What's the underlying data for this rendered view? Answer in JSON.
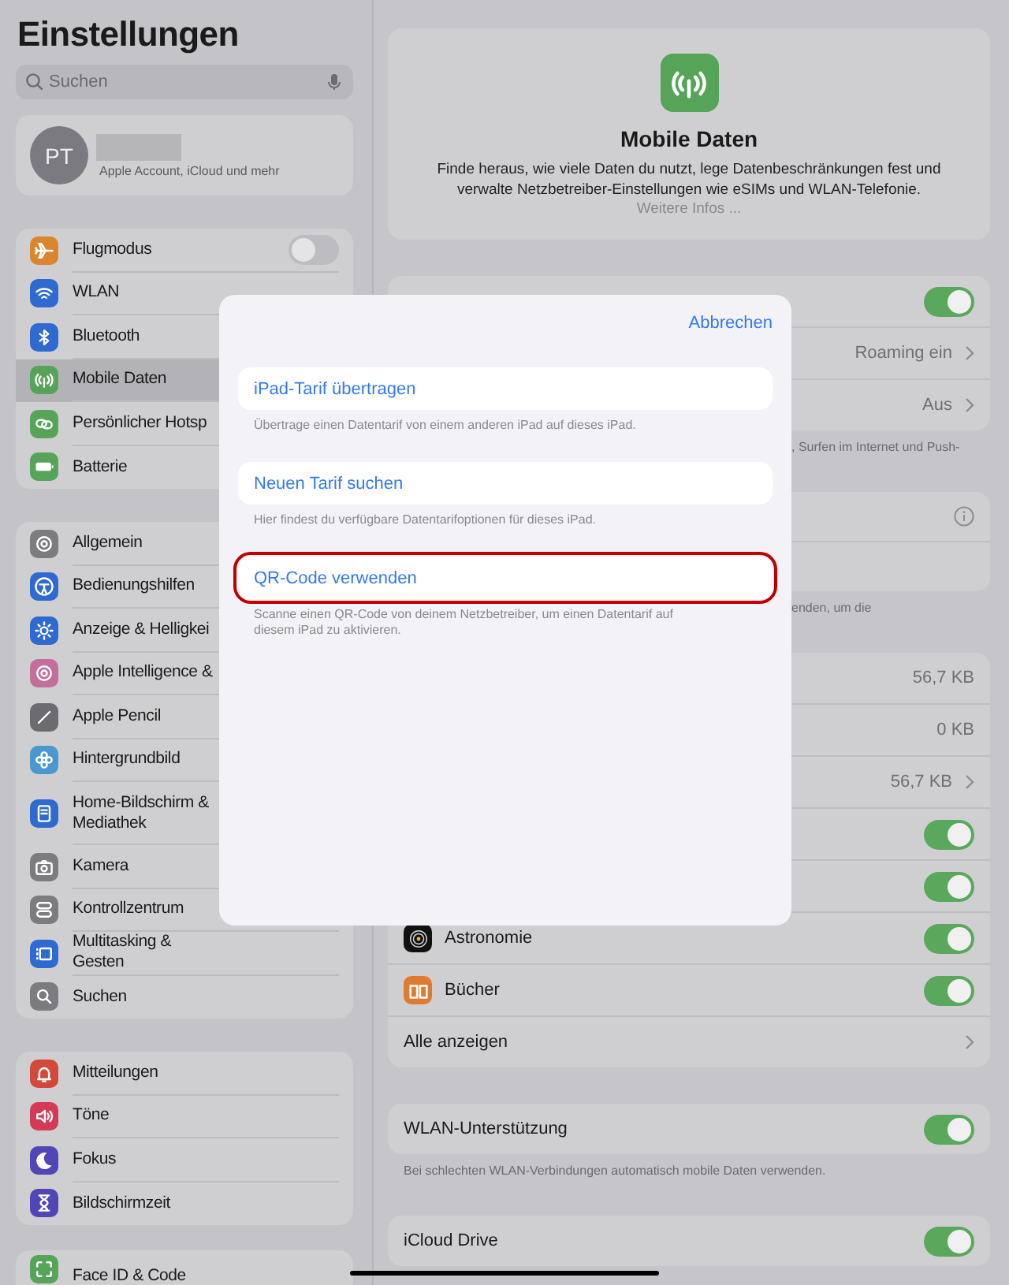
{
  "sidebar": {
    "title": "Einstellungen",
    "search": {
      "placeholder": "Suchen"
    },
    "account": {
      "initials": "PT",
      "subtitle": "Apple Account, iCloud und mehr"
    },
    "groups": [
      {
        "items": [
          {
            "label": "Flugmodus",
            "color": "#d9862f",
            "kind": "toggle",
            "on": false,
            "selected": false
          },
          {
            "label": "WLAN",
            "color": "#2f6ad0",
            "kind": "plain",
            "selected": false
          },
          {
            "label": "Bluetooth",
            "color": "#2f6ad0",
            "kind": "plain",
            "selected": false
          },
          {
            "label": "Mobile Daten",
            "color": "#55a458",
            "kind": "plain",
            "selected": true
          },
          {
            "label": "Persönlicher Hotsp",
            "color": "#55a458",
            "kind": "plain",
            "selected": false
          },
          {
            "label": "Batterie",
            "color": "#55a458",
            "kind": "plain",
            "selected": false
          }
        ]
      },
      {
        "items": [
          {
            "label": "Allgemein",
            "color": "#7c7c80",
            "kind": "plain",
            "selected": false
          },
          {
            "label": "Bedienungshilfen",
            "color": "#2f6ad0",
            "kind": "plain",
            "selected": false
          },
          {
            "label": "Anzeige & Helligkei",
            "color": "#2f6ad0",
            "kind": "plain",
            "selected": false
          },
          {
            "label": "Apple Intelligence &",
            "color": "#c46e9c",
            "kind": "plain",
            "selected": false
          },
          {
            "label": "Apple Pencil",
            "color": "#6c6c70",
            "kind": "plain",
            "selected": false
          },
          {
            "label": "Hintergrundbild",
            "color": "#4a98cc",
            "kind": "plain",
            "selected": false
          },
          {
            "label": "Home-Bildschirm & Mediathek",
            "color": "#2f6ad0",
            "kind": "plain",
            "selected": false
          },
          {
            "label": "Kamera",
            "color": "#7c7c80",
            "kind": "plain",
            "selected": false
          },
          {
            "label": "Kontrollzentrum",
            "color": "#7c7c80",
            "kind": "plain",
            "selected": false
          },
          {
            "label": "Multitasking & Gesten",
            "color": "#2f6ad0",
            "kind": "plain",
            "selected": false
          },
          {
            "label": "Suchen",
            "color": "#7c7c80",
            "kind": "plain",
            "selected": false
          }
        ]
      },
      {
        "items": [
          {
            "label": "Mitteilungen",
            "color": "#d4483a",
            "kind": "plain",
            "selected": false
          },
          {
            "label": "Töne",
            "color": "#d33a56",
            "kind": "plain",
            "selected": false
          },
          {
            "label": "Fokus",
            "color": "#5046b6",
            "kind": "plain",
            "selected": false
          },
          {
            "label": "Bildschirmzeit",
            "color": "#5046b6",
            "kind": "plain",
            "selected": false
          }
        ]
      },
      {
        "items": [
          {
            "label": "Face ID & Code",
            "color": "#55a458",
            "kind": "plain",
            "selected": false
          }
        ]
      }
    ]
  },
  "detail": {
    "header": {
      "title": "Mobile Daten",
      "text": "Finde heraus, wie viele Daten du nutzt, lege Datenbeschränkungen fest und verwalte Netzbetreiber-Einstellungen wie eSIMs und WLAN-Telefonie.",
      "link": "Weitere Infos ..."
    },
    "sections": [
      {
        "rows": [
          {
            "kind": "toggle",
            "on": true
          },
          {
            "kind": "value",
            "value": "Roaming ein",
            "chevron": true
          },
          {
            "kind": "value",
            "value": "Aus",
            "chevron": true
          }
        ],
        "footer": ", Surfen im Internet und Push-"
      },
      {
        "rows": [
          {
            "kind": "info"
          },
          {
            "kind": "blank"
          }
        ],
        "footer": "enden, um die"
      },
      {
        "rows": [
          {
            "kind": "value",
            "value": "56,7 KB",
            "chevron": false
          },
          {
            "kind": "value",
            "value": "0 KB",
            "chevron": false
          },
          {
            "kind": "value",
            "value": "56,7 KB",
            "chevron": true
          },
          {
            "kind": "toggle",
            "on": true
          },
          {
            "kind": "toggle",
            "on": true
          },
          {
            "kind": "app",
            "label": "Astronomie",
            "color": "#111111",
            "on": true
          },
          {
            "kind": "app",
            "label": "Bücher",
            "color": "#e07a2e",
            "on": true
          },
          {
            "kind": "link",
            "label": "Alle anzeigen"
          }
        ]
      },
      {
        "rows": [
          {
            "kind": "toggle",
            "label": "WLAN-Unterstützung",
            "on": true
          }
        ],
        "footer": "Bei schlechten WLAN-Verbindungen automatisch mobile Daten verwenden."
      },
      {
        "rows": [
          {
            "kind": "toggle",
            "label": "iCloud Drive",
            "on": true
          }
        ]
      }
    ]
  },
  "sheet": {
    "cancel": "Abbrechen",
    "options": [
      {
        "label": "iPad-Tarif übertragen",
        "note": "Übertrage einen Datentarif von einem anderen iPad auf dieses iPad.",
        "marked": false
      },
      {
        "label": "Neuen Tarif suchen",
        "note": "Hier findest du verfügbare Datentarifoptionen für dieses iPad.",
        "marked": false
      },
      {
        "label": "QR-Code verwenden",
        "note": "Scanne einen QR-Code von deinem Netzbetreiber, um einen Datentarif auf diesem iPad zu aktivieren.",
        "marked": true
      }
    ]
  }
}
